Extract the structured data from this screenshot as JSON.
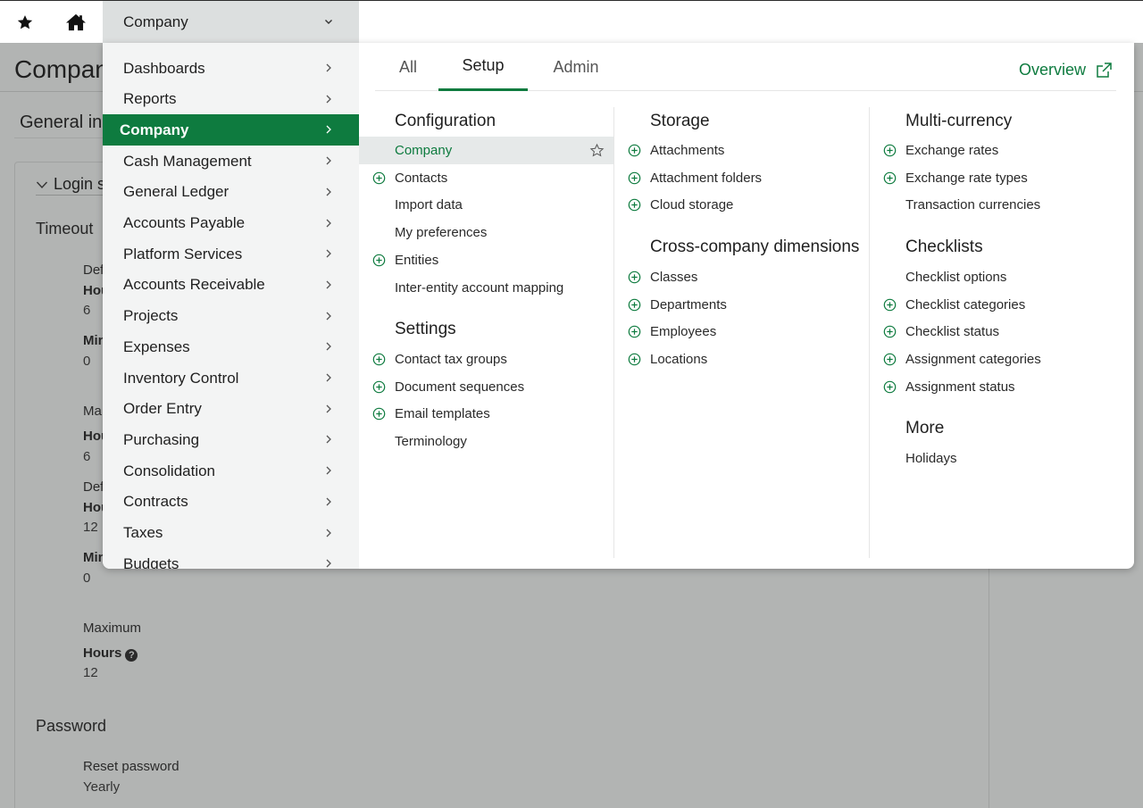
{
  "topbar": {
    "company_label": "Company"
  },
  "background_page": {
    "title": "Compan",
    "section": "General in",
    "login_heading": "Login s",
    "timeout_heading": "Timeout",
    "rows": [
      {
        "label": "Def",
        "field": "Hou",
        "value": "6"
      },
      {
        "field": "Min",
        "value": "0"
      },
      {
        "label": "Ma",
        "field": "Hou",
        "value": "6"
      },
      {
        "label": "Def",
        "field": "Hou",
        "value": "12"
      },
      {
        "field": "Min",
        "value": "0"
      }
    ],
    "maximum_label": "Maximum",
    "hours_label": "Hours",
    "hours_value": "12",
    "password_heading": "Password",
    "reset_label": "Reset password",
    "reset_value": "Yearly"
  },
  "menu": {
    "left_items": [
      {
        "label": "Dashboards"
      },
      {
        "label": "Reports"
      },
      {
        "label": "Company",
        "active": true
      },
      {
        "label": "Cash Management"
      },
      {
        "label": "General Ledger"
      },
      {
        "label": "Accounts Payable"
      },
      {
        "label": "Platform Services"
      },
      {
        "label": "Accounts Receivable"
      },
      {
        "label": "Projects"
      },
      {
        "label": "Expenses"
      },
      {
        "label": "Inventory Control"
      },
      {
        "label": "Order Entry"
      },
      {
        "label": "Purchasing"
      },
      {
        "label": "Consolidation"
      },
      {
        "label": "Contracts"
      },
      {
        "label": "Taxes"
      },
      {
        "label": "Budgets"
      }
    ],
    "tabs": [
      {
        "label": "All"
      },
      {
        "label": "Setup",
        "active": true
      },
      {
        "label": "Admin"
      }
    ],
    "overview_label": "Overview",
    "accent_color": "#0e7b3f",
    "col1": {
      "configuration": {
        "title": "Configuration",
        "items": [
          {
            "label": "Company",
            "plus": false,
            "selected": true
          },
          {
            "label": "Contacts",
            "plus": true
          },
          {
            "label": "Import data",
            "plus": false
          },
          {
            "label": "My preferences",
            "plus": false
          },
          {
            "label": "Entities",
            "plus": true
          },
          {
            "label": "Inter-entity account mapping",
            "plus": false
          }
        ]
      },
      "settings": {
        "title": "Settings",
        "items": [
          {
            "label": "Contact tax groups",
            "plus": true
          },
          {
            "label": "Document sequences",
            "plus": true
          },
          {
            "label": "Email templates",
            "plus": true
          },
          {
            "label": "Terminology",
            "plus": false
          }
        ]
      }
    },
    "col2": {
      "storage": {
        "title": "Storage",
        "items": [
          {
            "label": "Attachments",
            "plus": true
          },
          {
            "label": "Attachment folders",
            "plus": true
          },
          {
            "label": "Cloud storage",
            "plus": true
          }
        ]
      },
      "dimensions": {
        "title": "Cross-company dimensions",
        "items": [
          {
            "label": "Classes",
            "plus": true
          },
          {
            "label": "Departments",
            "plus": true
          },
          {
            "label": "Employees",
            "plus": true
          },
          {
            "label": "Locations",
            "plus": true
          }
        ]
      }
    },
    "col3": {
      "multicurrency": {
        "title": "Multi-currency",
        "items": [
          {
            "label": "Exchange rates",
            "plus": true
          },
          {
            "label": "Exchange rate types",
            "plus": true
          },
          {
            "label": "Transaction currencies",
            "plus": false
          }
        ]
      },
      "checklists": {
        "title": "Checklists",
        "items": [
          {
            "label": "Checklist options",
            "plus": false
          },
          {
            "label": "Checklist categories",
            "plus": true
          },
          {
            "label": "Checklist status",
            "plus": true
          },
          {
            "label": "Assignment categories",
            "plus": true
          },
          {
            "label": "Assignment status",
            "plus": true
          }
        ]
      },
      "more": {
        "title": "More",
        "items": [
          {
            "label": "Holidays",
            "plus": false
          }
        ]
      }
    }
  }
}
